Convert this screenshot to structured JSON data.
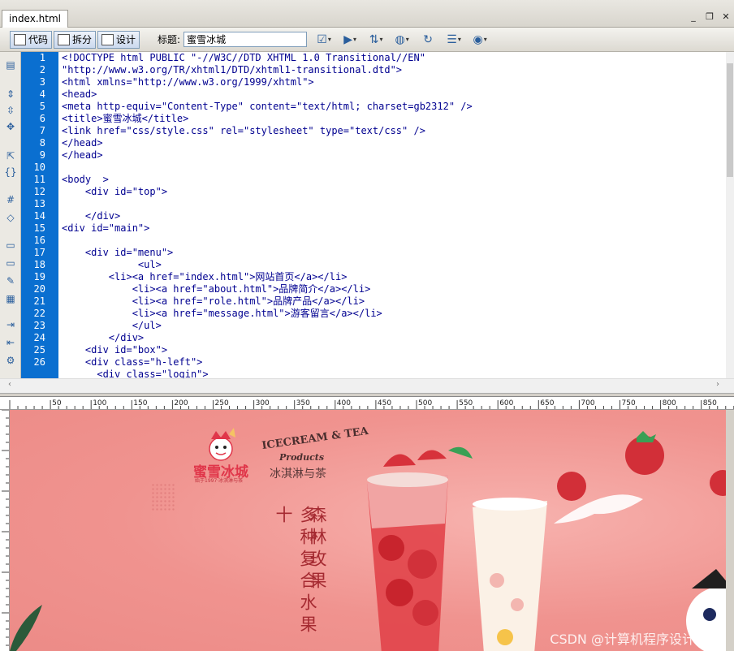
{
  "tab": {
    "title": "index.html"
  },
  "window": {
    "min": "_",
    "restore": "❐",
    "close": "✕"
  },
  "toolbar": {
    "code_label": "代码",
    "split_label": "拆分",
    "design_label": "设计",
    "title_label": "标题:",
    "title_value": "蜜雪冰城"
  },
  "code": {
    "line_numbers": [
      "1",
      "2",
      "3",
      "4",
      "5",
      "6",
      "7",
      "8",
      "9",
      "10",
      "11",
      "12",
      "13",
      "14",
      "15",
      "16",
      "17",
      "18",
      "19",
      "20",
      "21",
      "22",
      "23",
      "24",
      "25",
      "26"
    ],
    "lines": [
      "<!DOCTYPE html PUBLIC \"-//W3C//DTD XHTML 1.0 Transitional//EN\"",
      "\"http://www.w3.org/TR/xhtml1/DTD/xhtml1-transitional.dtd\">",
      "<html xmlns=\"http://www.w3.org/1999/xhtml\">",
      "<head>",
      "<meta http-equiv=\"Content-Type\" content=\"text/html; charset=gb2312\" />",
      "<title>蜜雪冰城</title>",
      "<link href=\"css/style.css\" rel=\"stylesheet\" type=\"text/css\" />",
      "</head>",
      "</head>",
      "",
      "<body  >",
      "    <div id=\"top\">",
      "",
      "    </div>",
      "<div id=\"main\">",
      "",
      "    <div id=\"menu\">",
      "             <ul>",
      "        <li><a href=\"index.html\">网站首页</a></li>",
      "            <li><a href=\"about.html\">品牌简介</a></li>",
      "            <li><a href=\"role.html\">品牌产品</a></li>",
      "            <li><a href=\"message.html\">游客留言</a></li>",
      "            </ul>",
      "        </div>",
      "    <div id=\"box\">",
      "    <div class=\"h-left\">",
      "      <div class=\"login\">"
    ]
  },
  "ruler": {
    "labels": [
      "50",
      "100",
      "150",
      "200",
      "250",
      "300",
      "350",
      "400",
      "450",
      "500",
      "550",
      "600",
      "650",
      "700",
      "750",
      "800",
      "850"
    ]
  },
  "preview": {
    "logo_name": "蜜雪冰城",
    "logo_sub": "始于1997·冰淇淋与茶",
    "brand_en": "ICECREAM & TEA",
    "brand_products": "Products",
    "brand_cn": "冰淇淋与茶",
    "vertical_left": "多种复合水果十",
    "vertical_right": "森林玫果",
    "watermark": "CSDN @计算机程序设计老师"
  },
  "colors": {
    "gutter": "#0a6fd0",
    "preview_bg": "#f3a29f",
    "accent_red": "#e0364a"
  }
}
